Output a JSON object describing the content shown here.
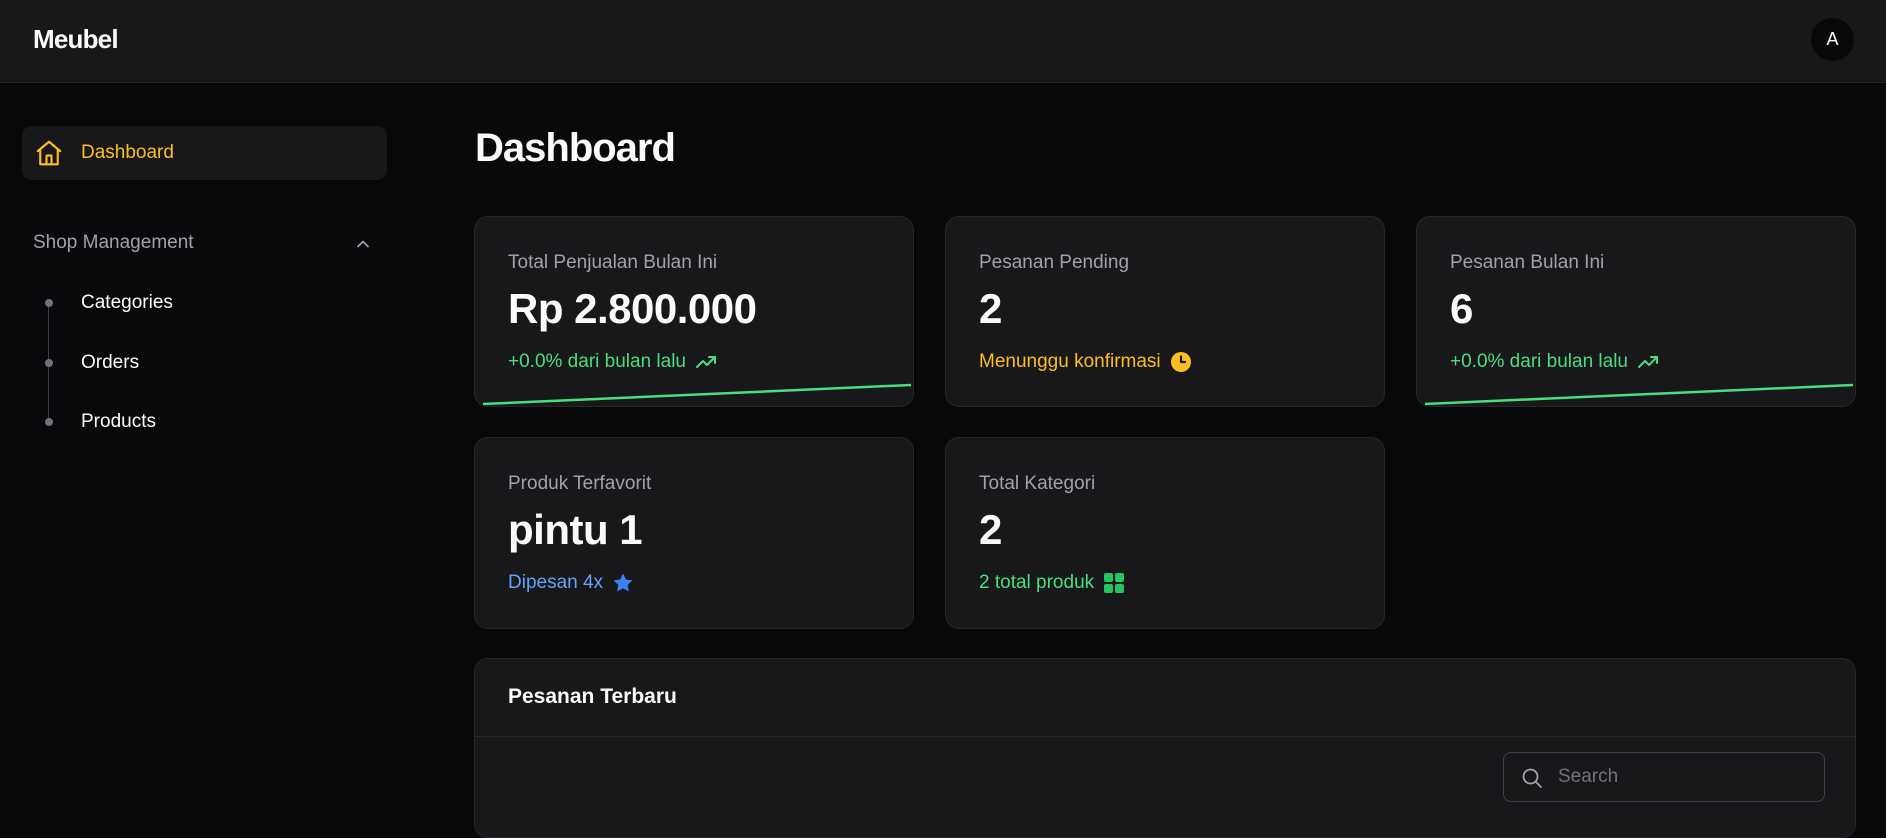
{
  "header": {
    "brand": "Meubel",
    "avatar_initial": "A"
  },
  "sidebar": {
    "active_item": {
      "label": "Dashboard",
      "icon": "home-icon"
    },
    "section": {
      "label": "Shop Management",
      "expanded": true,
      "items": [
        {
          "label": "Categories"
        },
        {
          "label": "Orders"
        },
        {
          "label": "Products"
        }
      ]
    }
  },
  "main": {
    "title": "Dashboard",
    "cards": [
      {
        "label": "Total Penjualan Bulan Ini",
        "value": "Rp 2.800.000",
        "sub": "+0.0% dari bulan lalu",
        "sub_icon": "trending-up-icon",
        "sub_color": "#4ade80"
      },
      {
        "label": "Pesanan Pending",
        "value": "2",
        "sub": "Menunggu konfirmasi",
        "sub_icon": "clock-icon",
        "sub_color": "#fbbf24"
      },
      {
        "label": "Pesanan Bulan Ini",
        "value": "6",
        "sub": "+0.0% dari bulan lalu",
        "sub_icon": "trending-up-icon",
        "sub_color": "#4ade80"
      },
      {
        "label": "Produk Terfavorit",
        "value": "pintu 1",
        "sub": "Dipesan 4x",
        "sub_icon": "star-icon",
        "sub_color": "#60a5fa"
      },
      {
        "label": "Total Kategori",
        "value": "2",
        "sub": "2 total produk",
        "sub_icon": "grid-icon",
        "sub_color": "#4ade80"
      }
    ],
    "recent_orders": {
      "title": "Pesanan Terbaru",
      "search_placeholder": "Search"
    }
  },
  "colors": {
    "background": "#09090b",
    "surface": "#18181b",
    "border": "#27272a",
    "accent": "#fbbf24",
    "positive": "#4ade80",
    "info": "#60a5fa"
  }
}
